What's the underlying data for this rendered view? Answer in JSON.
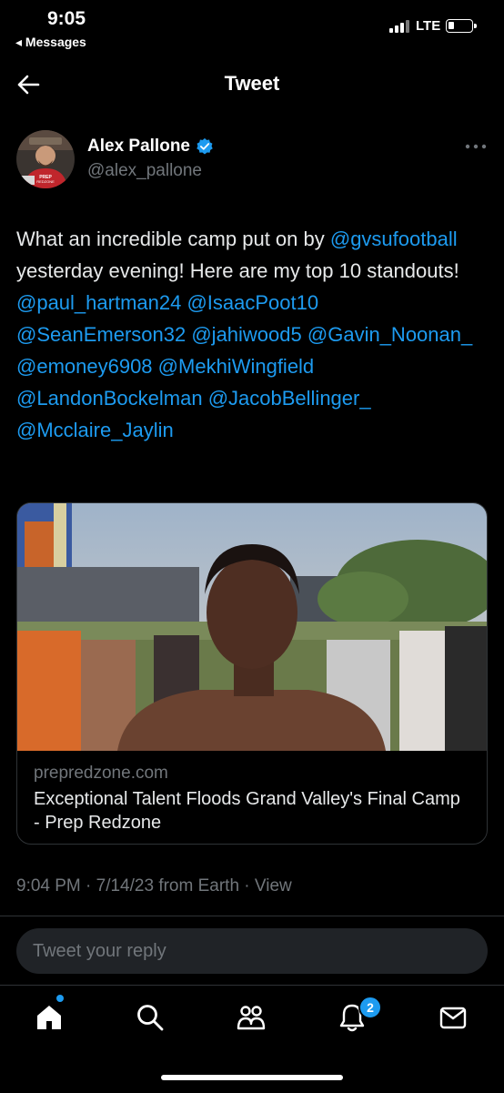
{
  "status_bar": {
    "time": "9:05",
    "back_app": "◂ Messages",
    "network": "LTE"
  },
  "header": {
    "title": "Tweet"
  },
  "tweet": {
    "author_name": "Alex Pallone",
    "handle": "@alex_pallone",
    "text": [
      {
        "t": "What an incredible camp put on by ",
        "m": false
      },
      {
        "t": "@gvsufootball",
        "m": true
      },
      {
        "t": " yesterday evening! Here are my top 10 standouts! ",
        "m": false
      },
      {
        "t": "@paul_hartman24",
        "m": true
      },
      {
        "t": " ",
        "m": false
      },
      {
        "t": "@IsaacPoot10",
        "m": true
      },
      {
        "t": " ",
        "m": false
      },
      {
        "t": "@SeanEmerson32",
        "m": true
      },
      {
        "t": "  ",
        "m": false
      },
      {
        "t": "@jahiwood5",
        "m": true
      },
      {
        "t": " ",
        "m": false
      },
      {
        "t": "@Gavin_Noonan_",
        "m": true
      },
      {
        "t": " ",
        "m": false
      },
      {
        "t": "@emoney6908",
        "m": true
      },
      {
        "t": " ",
        "m": false
      },
      {
        "t": "@MekhiWingfield",
        "m": true
      },
      {
        "t": " ",
        "m": false
      },
      {
        "t": "@LandonBockelman",
        "m": true
      },
      {
        "t": " ",
        "m": false
      },
      {
        "t": "@JacobBellinger_",
        "m": true
      },
      {
        "t": " ",
        "m": false
      },
      {
        "t": "@Mcclaire_Jaylin",
        "m": true
      }
    ],
    "card": {
      "domain": "prepredzone.com",
      "title": "Exceptional Talent Floods Grand Valley's Final Camp - Prep Redzone"
    },
    "meta": "9:04 PM · 7/14/23 from Earth · View"
  },
  "reply": {
    "placeholder": "Tweet your reply"
  },
  "tabbar": {
    "notifications_badge": "2"
  },
  "colors": {
    "accent": "#1d9bf0",
    "background": "#000000",
    "secondary_text": "#71767b"
  },
  "icons": [
    "back-arrow-icon",
    "verified-badge-icon",
    "more-icon",
    "home-icon",
    "search-icon",
    "communities-icon",
    "notifications-icon",
    "messages-icon"
  ]
}
